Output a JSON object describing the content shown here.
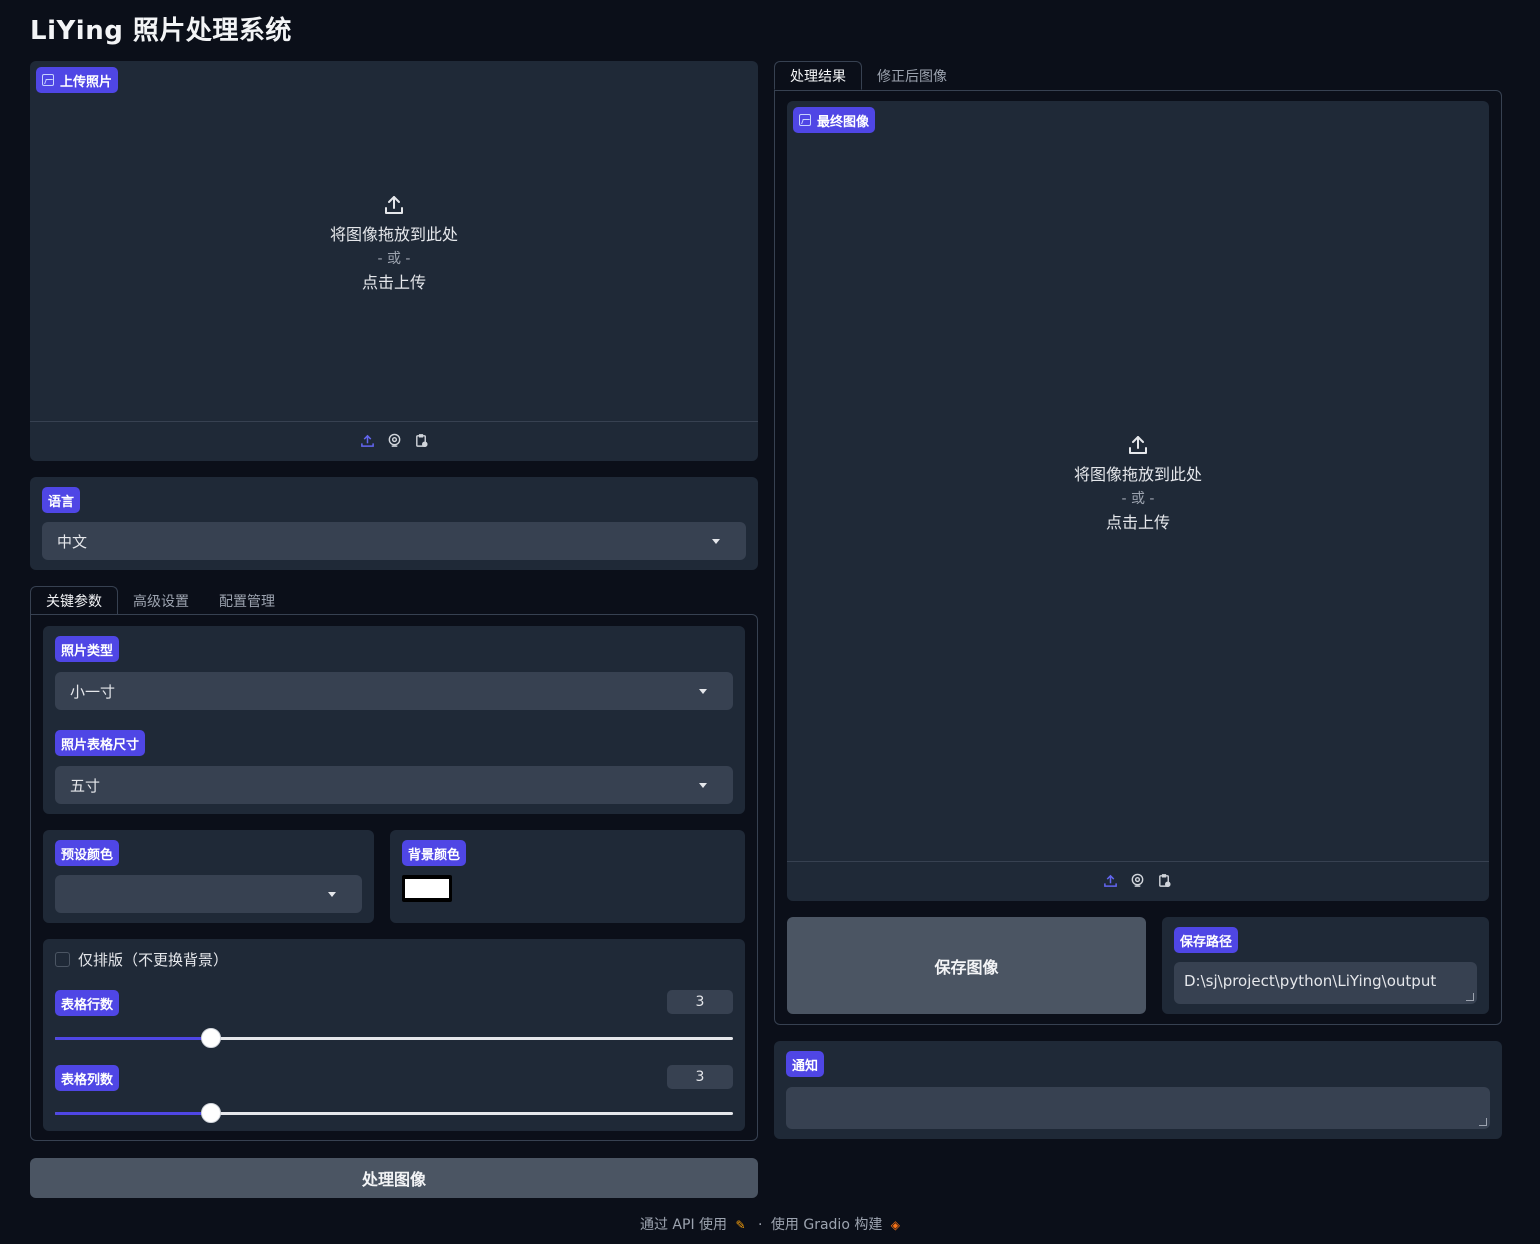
{
  "app": {
    "title": "LiYing 照片处理系统"
  },
  "upload": {
    "label": "上传照片",
    "drop_text": "将图像拖放到此处",
    "or_text": "- 或 -",
    "click_text": "点击上传"
  },
  "language": {
    "label": "语言",
    "value": "中文"
  },
  "left_tabs": {
    "key_params": "关键参数",
    "advanced": "高级设置",
    "config": "配置管理"
  },
  "params": {
    "photo_type_label": "照片类型",
    "photo_type_value": "小一寸",
    "sheet_size_label": "照片表格尺寸",
    "sheet_size_value": "五寸",
    "preset_color_label": "预设颜色",
    "preset_color_value": "",
    "bg_color_label": "背景颜色",
    "bg_color_value": "#ffffff",
    "layout_only_label": "仅排版（不更换背景）",
    "layout_only_checked": false,
    "rows_label": "表格行数",
    "rows_value": "3",
    "rows_fraction": 0.23,
    "cols_label": "表格列数",
    "cols_value": "3",
    "cols_fraction": 0.23
  },
  "process_button": "处理图像",
  "right_tabs": {
    "result": "处理结果",
    "corrected": "修正后图像"
  },
  "final_image": {
    "label": "最终图像",
    "drop_text": "将图像拖放到此处",
    "or_text": "- 或 -",
    "click_text": "点击上传"
  },
  "save": {
    "button": "保存图像",
    "path_label": "保存路径",
    "path_value": "D:\\sj\\project\\python\\LiYing\\output"
  },
  "notification": {
    "label": "通知",
    "value": ""
  },
  "footer": {
    "api_text": "通过 API 使用",
    "separator": "·",
    "built_text": "使用 Gradio 构建"
  },
  "colors": {
    "accent": "#4f46e5",
    "panel": "#1f2937",
    "background": "#0b0f19",
    "input": "#374151"
  }
}
